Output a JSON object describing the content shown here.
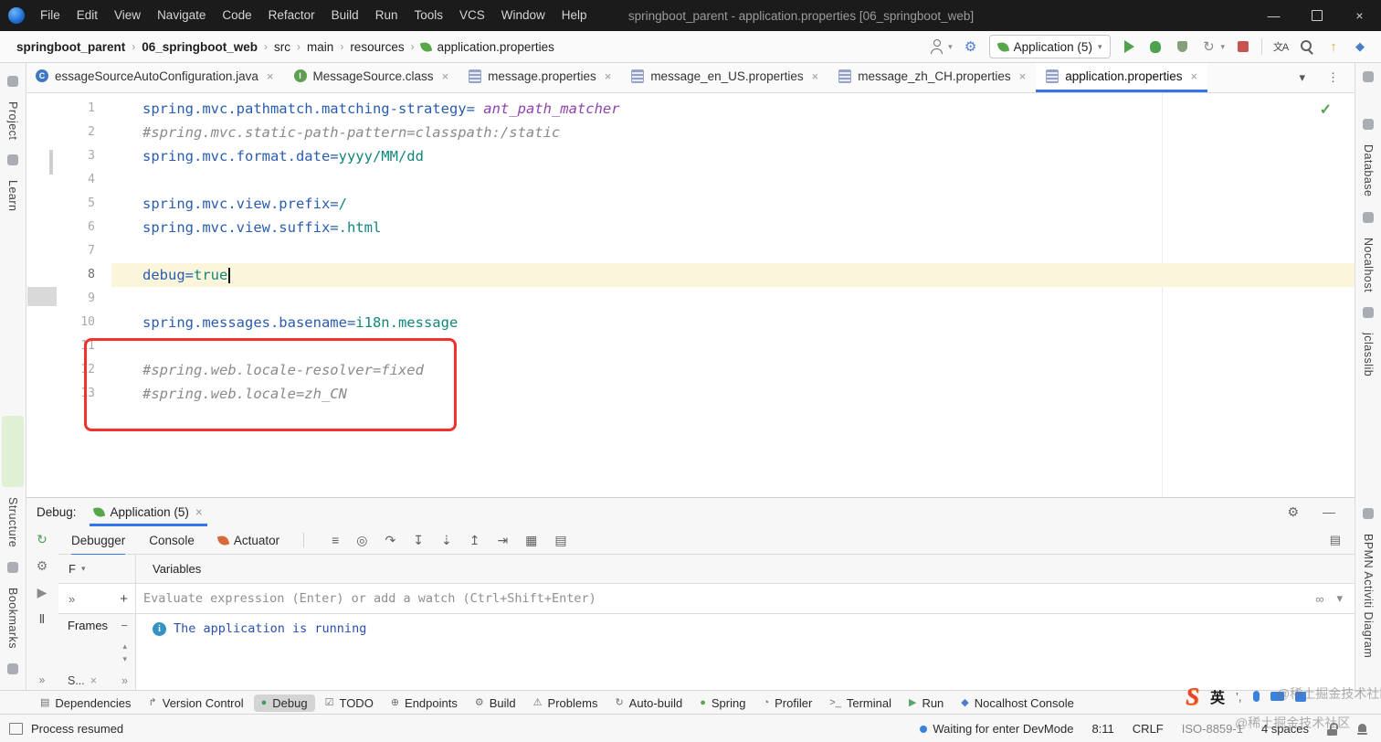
{
  "titlebar": {
    "menus": [
      "File",
      "Edit",
      "View",
      "Navigate",
      "Code",
      "Refactor",
      "Build",
      "Run",
      "Tools",
      "VCS",
      "Window",
      "Help"
    ],
    "title": "springboot_parent - application.properties [06_springboot_web]"
  },
  "glyphs": {
    "separator": "›",
    "dropdown": "▾",
    "close": "×",
    "minimize": "—",
    "gear": "⚙",
    "more": "⋮",
    "chevrons": "»",
    "add": "+",
    "collapse": "−",
    "watches": "∞",
    "layout": "▤",
    "check": "✓",
    "info": "i",
    "translate": "文A",
    "update": "↑",
    "services": "◆",
    "refresh": "↻",
    "up": "▴"
  },
  "navbar": {
    "breadcrumbs": [
      "springboot_parent",
      "06_springboot_web",
      "src",
      "main",
      "resources",
      "application.properties"
    ],
    "run_config": {
      "label": "Application (5)"
    }
  },
  "tab_bar": {
    "tabs": [
      {
        "label": "essageSourceAutoConfiguration.java",
        "icon": "java-class",
        "active": false
      },
      {
        "label": "MessageSource.class",
        "icon": "class",
        "active": false
      },
      {
        "label": "message.properties",
        "icon": "properties",
        "active": false
      },
      {
        "label": "message_en_US.properties",
        "icon": "properties",
        "active": false
      },
      {
        "label": "message_zh_CH.properties",
        "icon": "properties",
        "active": false
      },
      {
        "label": "application.properties",
        "icon": "properties",
        "active": true
      }
    ]
  },
  "editor": {
    "lines": [
      {
        "n": 1,
        "seg": [
          [
            "spring.mvc.pathmatch.matching-strategy=",
            "key"
          ],
          [
            " ant_path_matcher",
            "enum"
          ]
        ]
      },
      {
        "n": 2,
        "seg": [
          [
            "#spring.mvc.static-path-pattern=classpath:/static",
            "comment"
          ]
        ]
      },
      {
        "n": 3,
        "seg": [
          [
            "spring.mvc.format.date=",
            "key"
          ],
          [
            "yyyy/MM/dd",
            "value"
          ]
        ]
      },
      {
        "n": 4,
        "seg": []
      },
      {
        "n": 5,
        "seg": [
          [
            "spring.mvc.view.prefix=",
            "key"
          ],
          [
            "/",
            "value"
          ]
        ]
      },
      {
        "n": 6,
        "seg": [
          [
            "spring.mvc.view.suffix=",
            "key"
          ],
          [
            ".html",
            "value"
          ]
        ]
      },
      {
        "n": 7,
        "seg": []
      },
      {
        "n": 8,
        "seg": [
          [
            "debug=",
            "key"
          ],
          [
            "true",
            "value"
          ]
        ],
        "current": true
      },
      {
        "n": 9,
        "seg": []
      },
      {
        "n": 10,
        "seg": [
          [
            "spring.messages.basename=",
            "key"
          ],
          [
            "i18n.message",
            "value"
          ]
        ]
      },
      {
        "n": 11,
        "seg": []
      },
      {
        "n": 12,
        "seg": [
          [
            "#spring.web.locale-resolver=fixed",
            "comment"
          ]
        ]
      },
      {
        "n": 13,
        "seg": [
          [
            "#spring.web.locale=zh_CN",
            "comment"
          ]
        ]
      }
    ]
  },
  "debug_panel": {
    "title": "Debug:",
    "session_tab": "Application (5)",
    "view_tabs": [
      "Debugger",
      "Console",
      "Actuator"
    ],
    "active_view_tab": "Debugger",
    "toolbar_icons": [
      {
        "name": "layout-settings-icon",
        "glyph": "≡"
      },
      {
        "name": "show-execution-point-icon",
        "glyph": "◎"
      },
      {
        "name": "step-over-icon",
        "glyph": "↷"
      },
      {
        "name": "step-into-icon",
        "glyph": "↧"
      },
      {
        "name": "force-step-into-icon",
        "glyph": "⇣"
      },
      {
        "name": "step-out-icon",
        "glyph": "↥"
      },
      {
        "name": "run-to-cursor-icon",
        "glyph": "⇥"
      },
      {
        "name": "view-breakpoints-icon",
        "glyph": "▦"
      },
      {
        "name": "mute-breakpoints-icon",
        "glyph": "▤"
      }
    ],
    "strip_icons": [
      {
        "name": "rerun-debug-icon",
        "glyph": "↻",
        "color": "#4fa156"
      },
      {
        "name": "debug-settings-icon",
        "glyph": "⚙",
        "color": "#7a7a7a"
      },
      {
        "name": "resume-icon",
        "glyph": "▶",
        "color": "#8a8a8a"
      },
      {
        "name": "pause-icon",
        "glyph": "Ⅱ",
        "color": "#555555"
      }
    ],
    "thread_dropdown": "F",
    "variables_header": "Variables",
    "frames_header": "Frames",
    "watch_placeholder": "Evaluate expression (Enter) or add a watch (Ctrl+Shift+Enter)",
    "status_message": "The application is running",
    "collapsed_tab": "S..."
  },
  "tool_window_bar": {
    "items": [
      {
        "label": "Dependencies",
        "glyph": "▤",
        "color": "#6e6e6e",
        "active": false
      },
      {
        "label": "Version Control",
        "glyph": "↱",
        "color": "#6e6e6e",
        "active": false
      },
      {
        "label": "Debug",
        "glyph": "●",
        "color": "#3f9e59",
        "active": true
      },
      {
        "label": "TODO",
        "glyph": "☑",
        "color": "#6e6e6e",
        "active": false
      },
      {
        "label": "Endpoints",
        "glyph": "⊕",
        "color": "#6e6e6e",
        "active": false
      },
      {
        "label": "Build",
        "glyph": "⚙",
        "color": "#6e6e6e",
        "active": false
      },
      {
        "label": "Problems",
        "glyph": "⚠",
        "color": "#6e6e6e",
        "active": false
      },
      {
        "label": "Auto-build",
        "glyph": "↻",
        "color": "#6e6e6e",
        "active": false
      },
      {
        "label": "Spring",
        "glyph": "●",
        "color": "#57a64a",
        "active": false
      },
      {
        "label": "Profiler",
        "glyph": "◔",
        "color": "#6e6e6e",
        "active": false
      },
      {
        "label": "Terminal",
        "glyph": ">_",
        "color": "#6e6e6e",
        "active": false
      },
      {
        "label": "Run",
        "glyph": "▶",
        "color": "#59a869",
        "active": false
      },
      {
        "label": "Nocalhost Console",
        "glyph": "◆",
        "color": "#4a7ec9",
        "active": false
      }
    ]
  },
  "status_bar": {
    "process": "Process resumed",
    "devmode": "Waiting for enter DevMode",
    "caret_position": "8:11",
    "line_separator": "CRLF",
    "encoding": "ISO-8859-1",
    "indent": "4 spaces"
  },
  "stripes": {
    "left_top": [
      {
        "label": "Project",
        "icon": "project-icon"
      },
      {
        "label": "Learn",
        "icon": "learn-icon"
      }
    ],
    "left_bottom": [
      {
        "label": "Structure",
        "icon": "structure-icon"
      },
      {
        "label": "Bookmarks",
        "icon": "bookmarks-icon"
      }
    ],
    "right_top": [
      {
        "label": "Database",
        "icon": "database-icon"
      },
      {
        "label": "Nocalhost",
        "icon": "nocalhost-icon"
      },
      {
        "label": "jclasslib",
        "icon": "jclasslib-icon"
      }
    ],
    "right_bottom": [
      {
        "label": "BPMN Activiti Diagram",
        "icon": "bpmn-icon"
      }
    ]
  },
  "ime": {
    "logo": "S",
    "language": "英",
    "punctuation": "’,"
  },
  "watermark": "@稀土掘金技术社区"
}
